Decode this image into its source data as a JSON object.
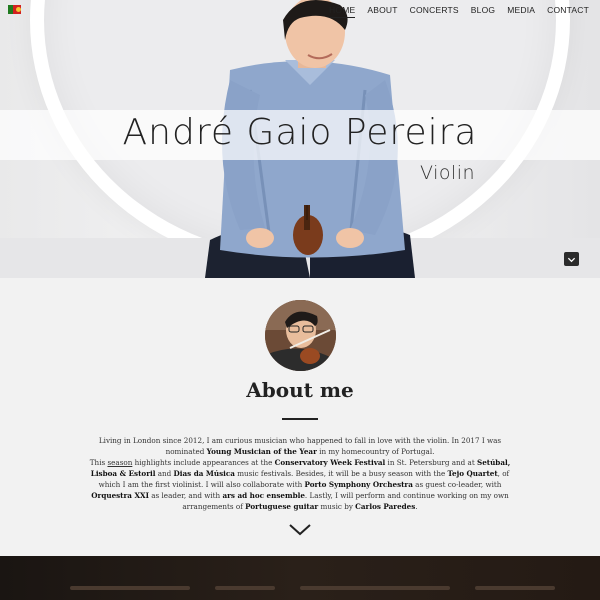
{
  "nav": {
    "items": [
      "HOME",
      "ABOUT",
      "CONCERTS",
      "BLOG",
      "MEDIA",
      "CONTACT"
    ],
    "active": "HOME"
  },
  "hero": {
    "name": "André Gaio Pereira",
    "subtitle": "Violin"
  },
  "about": {
    "title": "About me",
    "p1_a": "Living in London since 2012, I am curious musician who happened to fall in love with the violin. In 2017 I was nominated ",
    "p1_b": "Young Musician of the Year",
    "p1_c": " in my homecountry of Portugal.",
    "p2_a": "This ",
    "p2_link": "season",
    "p2_b": " highlights include appearances at the ",
    "p2_c": "Conservatory Week Festival",
    "p2_d": " in St. Petersburg and at ",
    "p2_e": "Setúbal, Lisboa & Estoril",
    "p2_f": " and ",
    "p2_g": "Dias da Música",
    "p2_h": " music festivals. Besides, it will be a busy season with the ",
    "p2_i": "Tejo Quartet",
    "p2_j": ", of which I am the first violinist. I will also collaborate with ",
    "p2_k": "Porto Symphony Orchestra",
    "p2_l": " as guest co-leader, with ",
    "p2_m": "Orquestra XXI",
    "p2_n": " as leader, and with ",
    "p2_o": "ars ad hoc ensemble",
    "p2_p": ". Lastly, I will perform and continue working on my own arrangements of ",
    "p2_q": "Portuguese guitar",
    "p2_r": " music by ",
    "p2_s": "Carlos Paredes",
    "p2_t": "."
  },
  "colors": {
    "accent": "#222222",
    "background": "#f2f2f2"
  }
}
